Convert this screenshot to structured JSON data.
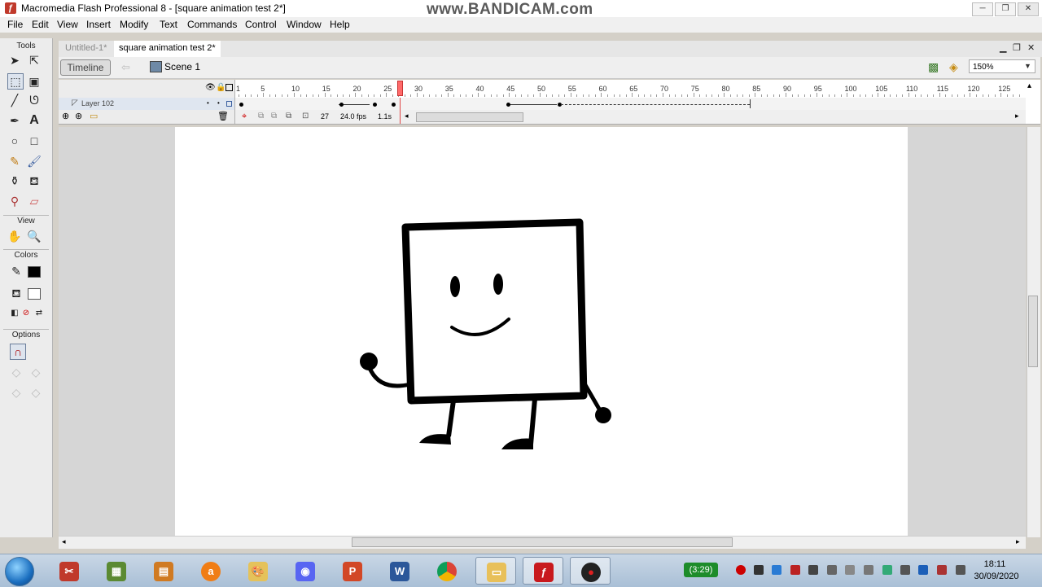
{
  "window": {
    "title": "Macromedia Flash Professional 8 - [square animation test 2*]",
    "watermark": "www.BANDICAM.com",
    "controls": [
      "minimize",
      "restore",
      "close"
    ]
  },
  "menu": [
    "File",
    "Edit",
    "View",
    "Insert",
    "Modify",
    "Text",
    "Commands",
    "Control",
    "Window",
    "Help"
  ],
  "tools": {
    "label": "Tools",
    "view_label": "View",
    "colors_label": "Colors",
    "options_label": "Options",
    "items": [
      "selection-tool",
      "subselection-tool",
      "free-transform-tool",
      "fill-transform-tool",
      "line-tool",
      "lasso-tool",
      "pen-tool",
      "text-tool",
      "oval-tool",
      "rectangle-tool",
      "pencil-tool",
      "brush-tool",
      "ink-bottle-tool",
      "paint-bucket-tool",
      "eyedropper-tool",
      "eraser-tool"
    ],
    "view_items": [
      "hand-tool",
      "zoom-tool"
    ],
    "stroke_color": "#000000",
    "fill_color": "#ffffff",
    "option_selected": "snap-to-objects"
  },
  "doc_tabs": [
    {
      "label": "Untitled-1*",
      "active": false
    },
    {
      "label": "square animation test 2*",
      "active": true
    }
  ],
  "editbar": {
    "timeline_button": "Timeline",
    "scene_label": "Scene 1",
    "zoom": "150%"
  },
  "timeline": {
    "layer_name": "Layer 102",
    "ruler_labels": [
      "1",
      "5",
      "10",
      "15",
      "20",
      "25",
      "30",
      "35",
      "40",
      "45",
      "50",
      "55",
      "60",
      "65",
      "70",
      "75",
      "80",
      "85",
      "90",
      "95",
      "100",
      "105",
      "110",
      "115",
      "120",
      "125"
    ],
    "current_frame": "27",
    "frame_rate": "24.0 fps",
    "elapsed": "1.1s",
    "playhead_frame": 27
  },
  "taskbar": {
    "apps": [
      "snipping-tool",
      "minecraft",
      "file-manager",
      "avast",
      "paint",
      "discord",
      "powerpoint",
      "word",
      "chrome",
      "explorer",
      "flash",
      "bandicam"
    ],
    "timer": "(3:29)",
    "time": "18:11",
    "date": "30/09/2020"
  },
  "colors": {
    "playhead": "#ff6a6a",
    "stage": "#ffffff",
    "work_area": "#d6d6d6"
  }
}
